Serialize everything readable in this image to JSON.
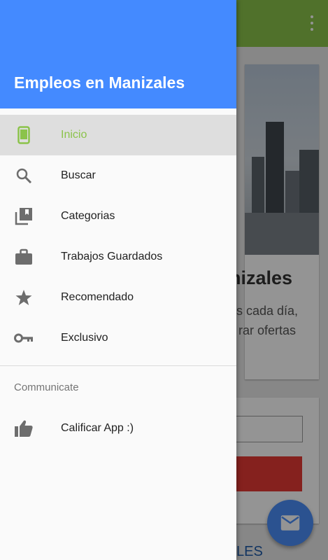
{
  "background": {
    "card_heading": "nizales",
    "card_text_line1": "s cada día,",
    "card_text_line2": "rar ofertas",
    "link_text": "LES"
  },
  "drawer": {
    "title": "Empleos en Manizales",
    "items": [
      {
        "label": "Inicio",
        "icon": "phone-icon",
        "active": true
      },
      {
        "label": "Buscar",
        "icon": "search-icon",
        "active": false
      },
      {
        "label": "Categorias",
        "icon": "collections-icon",
        "active": false
      },
      {
        "label": "Trabajos Guardados",
        "icon": "briefcase-icon",
        "active": false
      },
      {
        "label": "Recomendado",
        "icon": "star-icon",
        "active": false
      },
      {
        "label": "Exclusivo",
        "icon": "key-icon",
        "active": false
      }
    ],
    "section_header": "Communicate",
    "section_items": [
      {
        "label": "Calificar App :)",
        "icon": "thumbs-up-icon"
      }
    ]
  },
  "colors": {
    "header_blue": "#448aff",
    "active_green": "#8bc34a",
    "toolbar_green": "#8bc34a",
    "fab_blue": "#4a8df8"
  }
}
